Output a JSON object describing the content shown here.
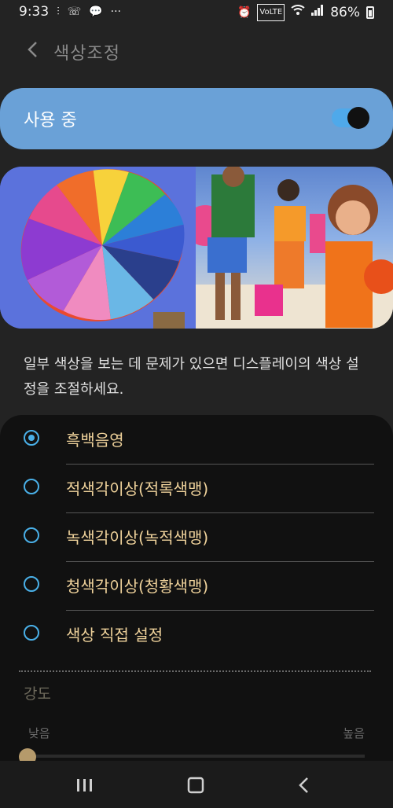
{
  "status_bar": {
    "time": "9:33",
    "icons_left": [
      "notification-icon",
      "call-icon",
      "talk-icon",
      "more-icon"
    ],
    "icons_right": [
      "alarm-icon",
      "volte-icon",
      "wifi-icon",
      "signal-icon"
    ],
    "battery": "86%"
  },
  "header": {
    "title": "색상조정",
    "back_icon": "chevron-left-icon"
  },
  "toggle": {
    "label": "사용 중",
    "on": true,
    "accent": "#6aa1d7"
  },
  "preview": {
    "left_image": "hot-air-balloon",
    "right_image": "family-on-beach"
  },
  "description": "일부 색상을 보는 데 문제가 있으면 디스플레이의 색상 설정을 조절하세요.",
  "options": [
    {
      "label": "흑백음영",
      "selected": true
    },
    {
      "label": "적색각이상(적록색맹)",
      "selected": false
    },
    {
      "label": "녹색각이상(녹적색맹)",
      "selected": false
    },
    {
      "label": "청색각이상(청황색맹)",
      "selected": false
    },
    {
      "label": "색상 직접 설정",
      "selected": false
    }
  ],
  "intensity": {
    "label": "강도",
    "low": "낮음",
    "high": "높음",
    "value": 0
  },
  "navbar": [
    "recents-icon",
    "home-icon",
    "back-icon"
  ]
}
